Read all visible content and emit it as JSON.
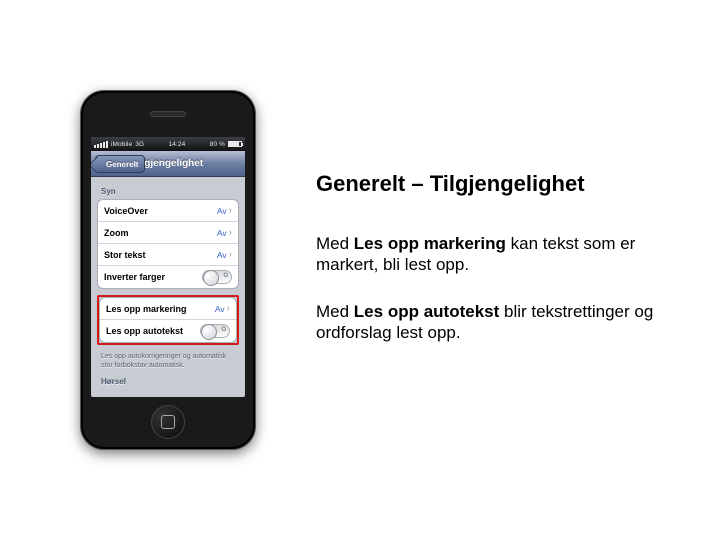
{
  "slide": {
    "heading": "Generelt – Tilgjengelighet",
    "para1_pre": "Med ",
    "para1_bold": "Les opp markering",
    "para1_post": " kan tekst som er markert, bli lest opp.",
    "para2_pre": "Med ",
    "para2_bold": "Les opp autotekst",
    "para2_post": " blir tekstrettinger og ordforslag lest opp."
  },
  "phone": {
    "statusbar": {
      "carrier": "iMobile",
      "net": "3G",
      "time": "14:24",
      "battery_pct": "80 %"
    },
    "nav": {
      "back": "Generelt",
      "title": "Tilgjengelighet"
    },
    "section_syn": "Syn",
    "rows": {
      "voiceover": {
        "label": "VoiceOver",
        "value": "Av"
      },
      "zoom": {
        "label": "Zoom",
        "value": "Av"
      },
      "stor_tekst": {
        "label": "Stor tekst",
        "value": "Av"
      },
      "inverter": {
        "label": "Inverter farger"
      },
      "les_mark": {
        "label": "Les opp markering",
        "value": "Av"
      },
      "les_auto": {
        "label": "Les opp autotekst"
      }
    },
    "toggle_off_glyph": "O",
    "footnote": "Les opp autokorrigeringer og automatisk stor forbokstav automatisk.",
    "section_horsel": "Hørsel"
  }
}
